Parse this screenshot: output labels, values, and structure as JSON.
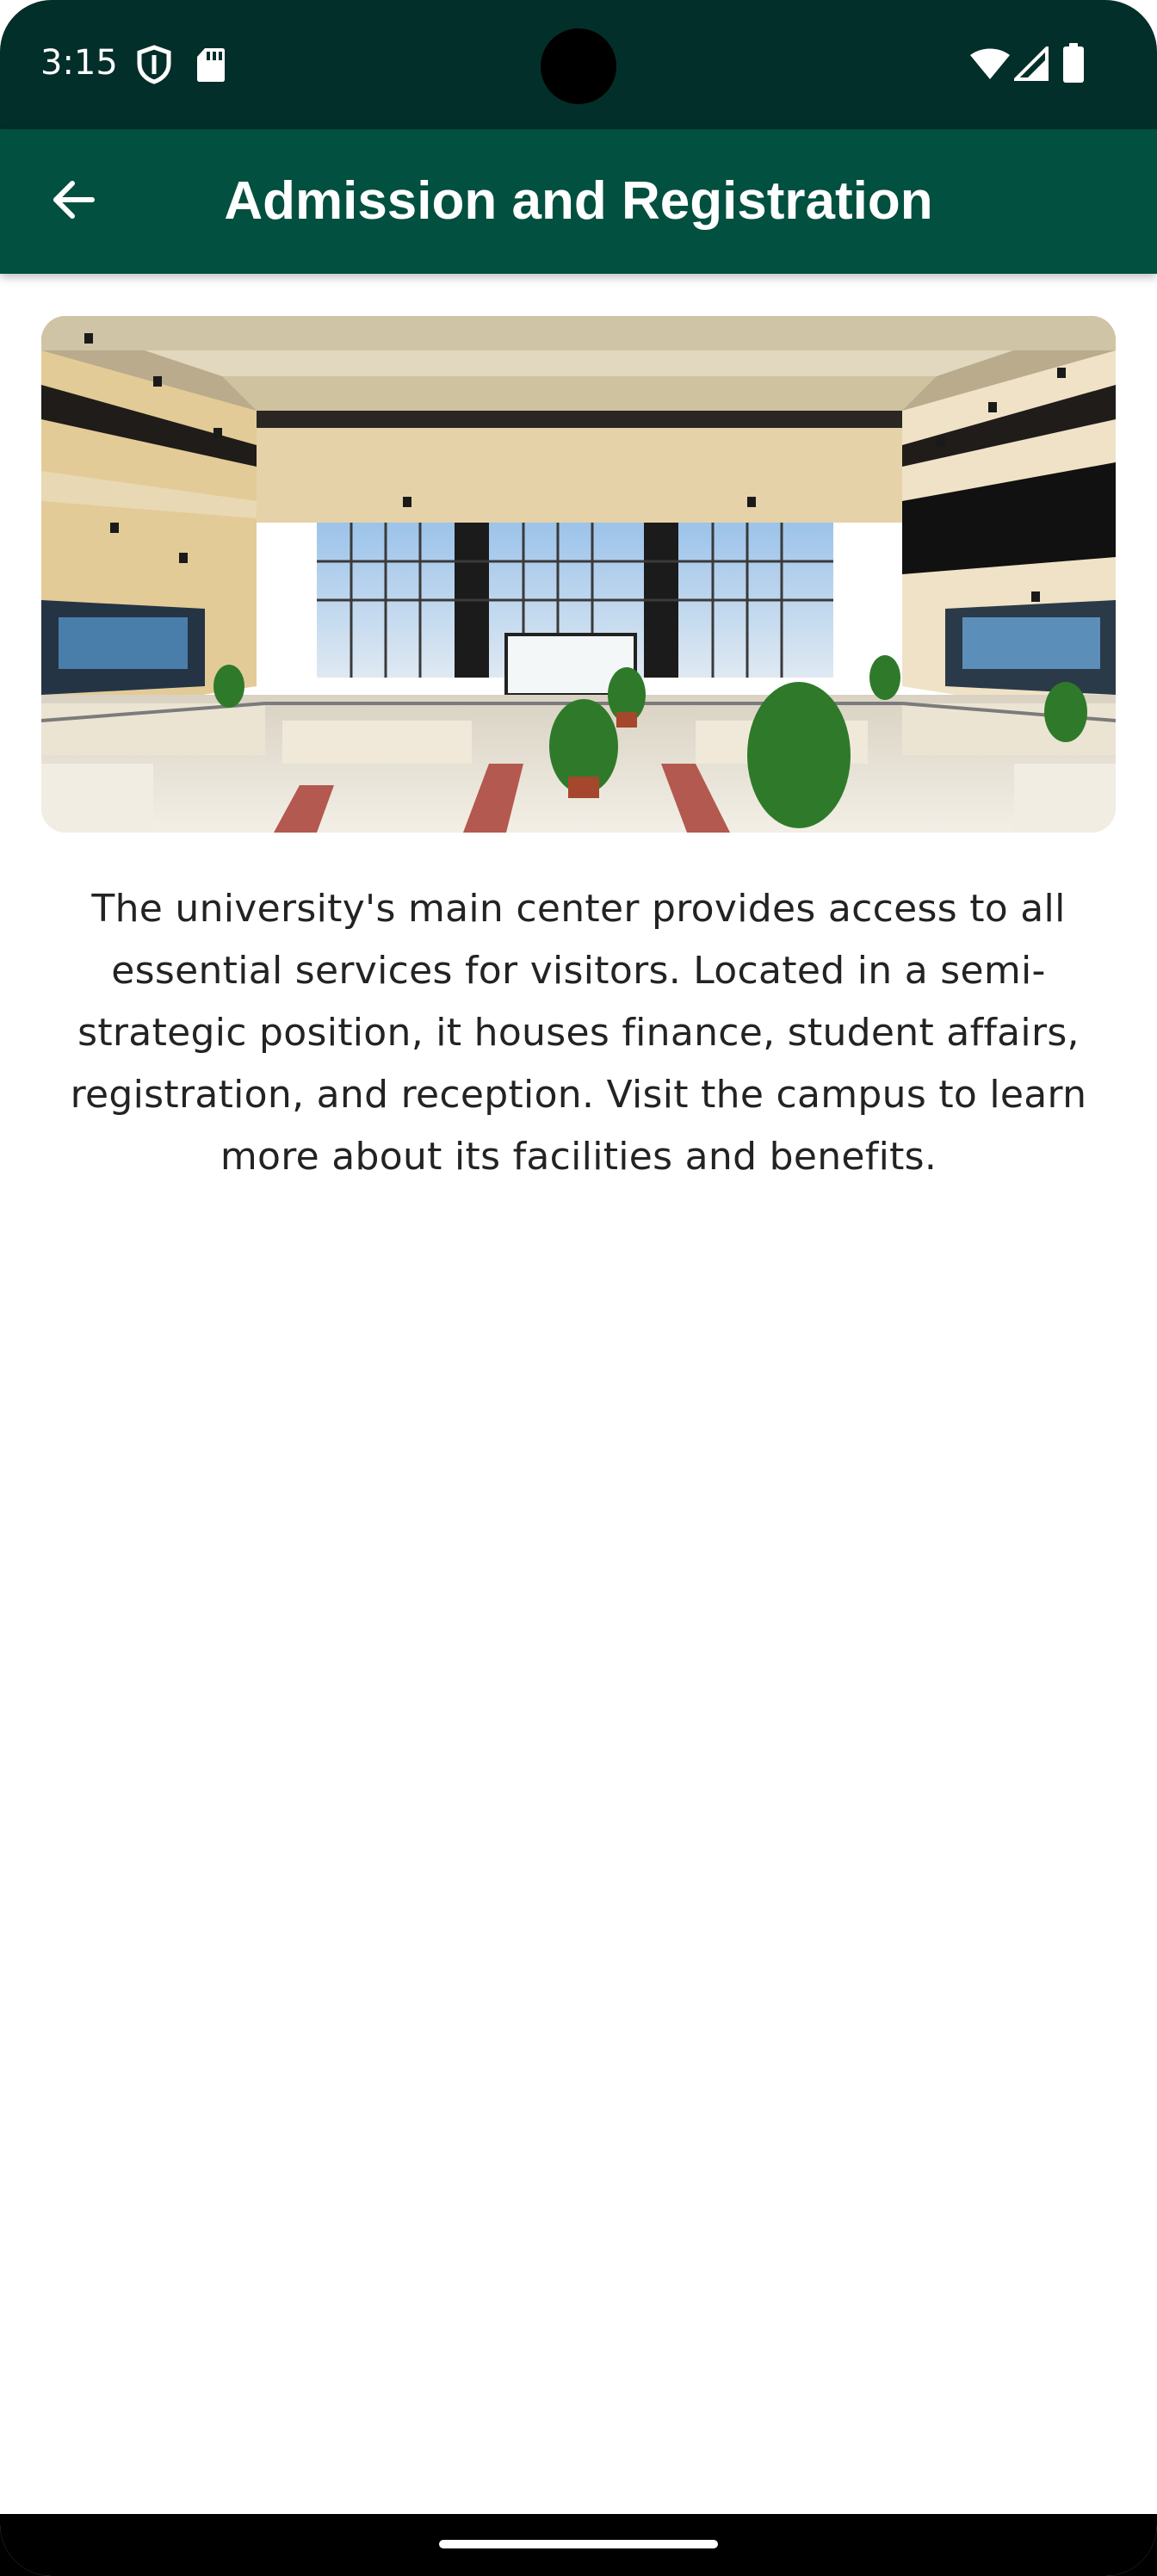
{
  "status_bar": {
    "time": "3:15",
    "icons": [
      "shield-icon",
      "sd-card-icon",
      "wifi-icon",
      "signal-icon",
      "battery-icon"
    ]
  },
  "app_bar": {
    "title": "Admission and Registration",
    "back_icon": "arrow-back-icon",
    "background_color": "#02503f"
  },
  "hero_image": {
    "subject": "university main hall interior"
  },
  "description": "The university's main center provides access to all essential services for visitors. Located in a semi-strategic position, it houses finance, student affairs, registration, and reception. Visit the campus to learn more about its facilities and benefits."
}
